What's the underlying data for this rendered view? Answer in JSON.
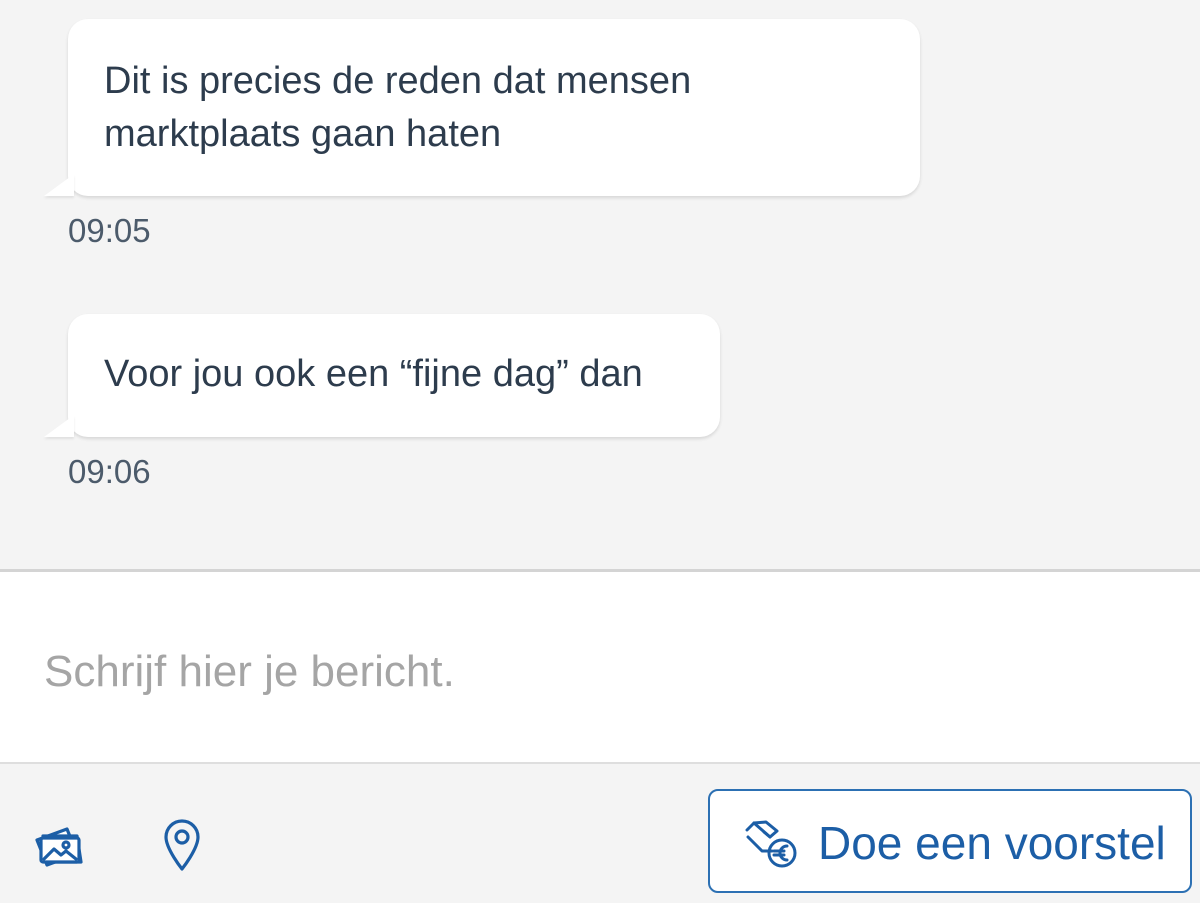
{
  "messages": [
    {
      "text": "Dit is precies de reden dat mensen marktplaats gaan haten",
      "time": "09:05"
    },
    {
      "text": "Voor jou ook een “fijne dag” dan",
      "time": "09:06"
    }
  ],
  "composer": {
    "placeholder": "Schrijf hier je bericht."
  },
  "toolbar": {
    "photo_icon": "photo-gallery-icon",
    "location_icon": "location-pin-icon",
    "offer_icon": "hand-euro-icon",
    "offer_label": "Doe een voorstel"
  },
  "colors": {
    "accent": "#1c5ea6",
    "text": "#2d3c4d",
    "timestamp": "#4c5b6b",
    "background": "#f4f4f4"
  }
}
